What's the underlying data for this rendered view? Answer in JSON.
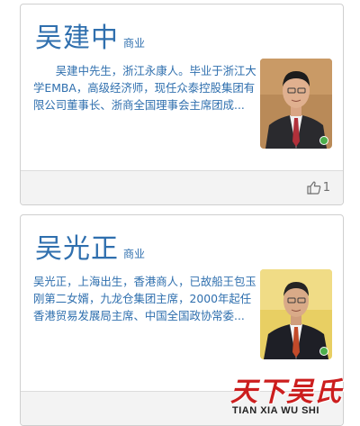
{
  "cards": [
    {
      "name": "吴建中",
      "category": "商业",
      "bio": "吴建中先生，浙江永康人。毕业于浙江大学EMBA，高级经济师，现任众泰控股集团有限公司董事长、浙商全国理事会主席团成...",
      "likes": "1",
      "online_color": "#4cae4c"
    },
    {
      "name": "吴光正",
      "category": "商业",
      "bio": "吴光正，上海出生，香港商人，已故船王包玉刚第二女婿，九龙仓集团主席，2000年起任香港贸易发展局主席、中国全国政协常委..."
    }
  ],
  "watermark": {
    "logo_text": "天下吴氏",
    "subtitle": "TIAN XIA WU SHI"
  },
  "colors": {
    "accent": "#2f6fae",
    "footer_bg": "#f3f3f3",
    "watermark_red": "#cc1e1e"
  }
}
